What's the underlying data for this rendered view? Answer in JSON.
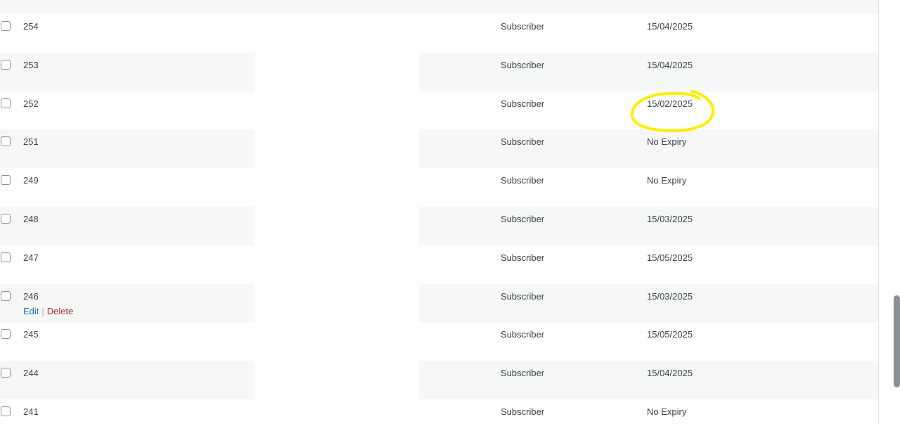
{
  "table": {
    "rows": [
      {
        "id": "254",
        "role": "Subscriber",
        "expiry": "15/04/2025"
      },
      {
        "id": "253",
        "role": "Subscriber",
        "expiry": "15/04/2025"
      },
      {
        "id": "252",
        "role": "Subscriber",
        "expiry": "15/02/2025"
      },
      {
        "id": "251",
        "role": "Subscriber",
        "expiry": "No Expiry"
      },
      {
        "id": "249",
        "role": "Subscriber",
        "expiry": "No Expiry"
      },
      {
        "id": "248",
        "role": "Subscriber",
        "expiry": "15/03/2025"
      },
      {
        "id": "247",
        "role": "Subscriber",
        "expiry": "15/05/2025"
      },
      {
        "id": "246",
        "role": "Subscriber",
        "expiry": "15/03/2025"
      },
      {
        "id": "245",
        "role": "Subscriber",
        "expiry": "15/05/2025"
      },
      {
        "id": "244",
        "role": "Subscriber",
        "expiry": "15/04/2025"
      },
      {
        "id": "241",
        "role": "Subscriber",
        "expiry": "No Expiry"
      }
    ]
  },
  "row_actions": {
    "edit_label": "Edit",
    "separator": "|",
    "delete_label": "Delete"
  },
  "colors": {
    "alt_row": "#f6f7f7",
    "edit_link": "#2271b1",
    "delete_link": "#b32d2e",
    "highlight": "#ffee00"
  }
}
